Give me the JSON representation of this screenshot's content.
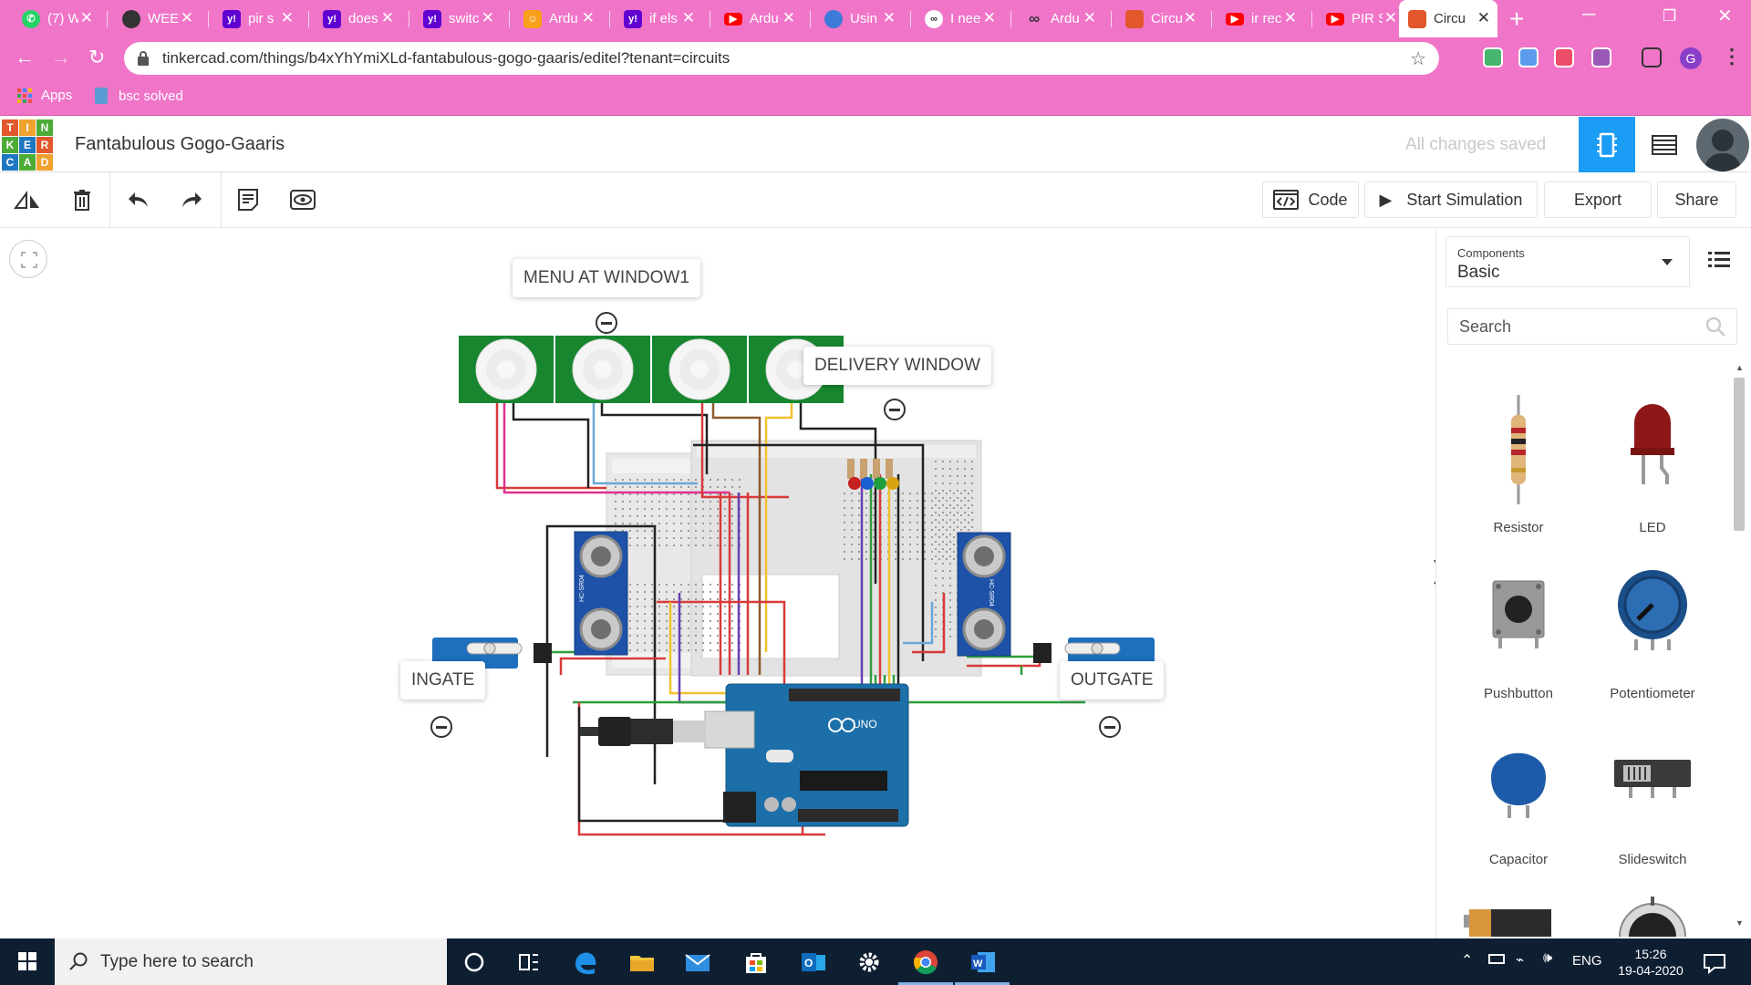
{
  "browser": {
    "tabs": [
      {
        "label": "(7) W",
        "favicon": "whatsapp-icon",
        "color": "#25d366"
      },
      {
        "label": "WEE",
        "favicon": "globe-icon",
        "color": "#333333"
      },
      {
        "label": "pir s",
        "favicon": "yahoo-icon",
        "color": "#6001d2"
      },
      {
        "label": "does",
        "favicon": "yahoo-icon",
        "color": "#6001d2"
      },
      {
        "label": "switc",
        "favicon": "yahoo-icon",
        "color": "#6001d2"
      },
      {
        "label": "Ardu",
        "favicon": "instructables-icon",
        "color": "#f9a01b"
      },
      {
        "label": "if els",
        "favicon": "yahoo-icon",
        "color": "#6001d2"
      },
      {
        "label": "Ardu",
        "favicon": "youtube-icon",
        "color": "#ff0000"
      },
      {
        "label": "Usin",
        "favicon": "site-icon",
        "color": "#3c7bd9"
      },
      {
        "label": "I nee",
        "favicon": "arduino-icon",
        "color": "#333333"
      },
      {
        "label": "Ardu",
        "favicon": "arduino-icon",
        "color": "#333333"
      },
      {
        "label": "Circu",
        "favicon": "tinkercad-icon",
        "color": "#e2572b"
      },
      {
        "label": "ir rec",
        "favicon": "youtube-icon",
        "color": "#ff0000"
      },
      {
        "label": "PIR S",
        "favicon": "youtube-icon",
        "color": "#ff0000"
      },
      {
        "label": "Circu",
        "favicon": "tinkercad-icon",
        "color": "#e2572b",
        "active": true
      }
    ],
    "url": "tinkercad.com/things/b4xYhYmiXLd-fantabulous-gogo-gaaris/editel?tenant=circuits",
    "bookmarks": {
      "apps": "Apps",
      "folder": "bsc solved"
    },
    "profile_initial": "G",
    "theme_color": "#f075c8"
  },
  "app": {
    "title": "Fantabulous Gogo-Gaaris",
    "save_status": "All changes saved",
    "logo_letters": [
      "T",
      "I",
      "N",
      "K",
      "E",
      "R",
      "C",
      "A",
      "D"
    ],
    "accent": "#1b9cf5"
  },
  "toolbar": {
    "code_label": "Code",
    "simulate_label": "Start Simulation",
    "export_label": "Export",
    "share_label": "Share"
  },
  "canvas": {
    "notes": {
      "menu": "MENU AT WINDOW1",
      "delivery": "DELIVERY WINDOW",
      "ingate": "INGATE",
      "outgate": "OUTGATE"
    },
    "sensor_label": "HC-SR04",
    "arduino_label": "UNO"
  },
  "panel": {
    "components_label": "Components",
    "components_value": "Basic",
    "search_placeholder": "Search",
    "components": [
      {
        "name": "Resistor",
        "icon": "resistor-icon"
      },
      {
        "name": "LED",
        "icon": "led-icon"
      },
      {
        "name": "Pushbutton",
        "icon": "pushbutton-icon"
      },
      {
        "name": "Potentiometer",
        "icon": "potentiometer-icon"
      },
      {
        "name": "Capacitor",
        "icon": "capacitor-icon"
      },
      {
        "name": "Slideswitch",
        "icon": "slideswitch-icon"
      }
    ]
  },
  "taskbar": {
    "search_placeholder": "Type here to search",
    "language": "ENG",
    "time": "15:26",
    "date": "19-04-2020"
  }
}
